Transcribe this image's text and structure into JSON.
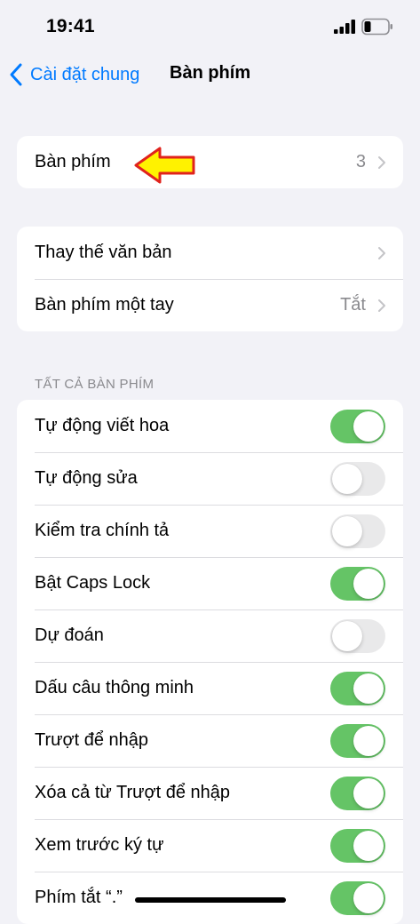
{
  "status_bar": {
    "time": "19:41"
  },
  "nav": {
    "back_label": "Cài đặt chung",
    "title": "Bàn phím"
  },
  "group1": {
    "keyboards_label": "Bàn phím",
    "keyboards_value": "3"
  },
  "group2": {
    "text_replacement_label": "Thay thế văn bản",
    "one_handed_label": "Bàn phím một tay",
    "one_handed_value": "Tắt"
  },
  "all_keyboards": {
    "header": "TẤT CẢ BÀN PHÍM",
    "items": [
      {
        "label": "Tự động viết hoa",
        "on": true
      },
      {
        "label": "Tự động sửa",
        "on": false
      },
      {
        "label": "Kiểm tra chính tả",
        "on": false
      },
      {
        "label": "Bật Caps Lock",
        "on": true
      },
      {
        "label": "Dự đoán",
        "on": false
      },
      {
        "label": "Dấu câu thông minh",
        "on": true
      },
      {
        "label": "Trượt để nhập",
        "on": true
      },
      {
        "label": "Xóa cả từ Trượt để nhập",
        "on": true
      },
      {
        "label": "Xem trước ký tự",
        "on": true
      },
      {
        "label": "Phím tắt “.”",
        "on": true
      }
    ]
  },
  "colors": {
    "accent": "#007aff",
    "toggle_on": "#65c466",
    "toggle_off": "#e9e9ea",
    "annotation_arrow_fill": "#fff200",
    "annotation_arrow_stroke": "#e0231c"
  }
}
